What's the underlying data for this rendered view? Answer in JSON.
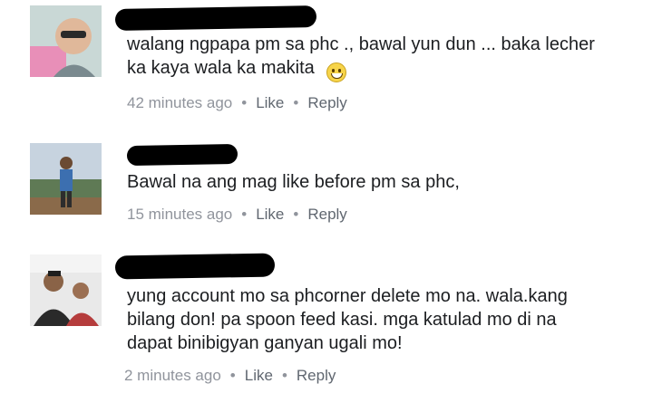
{
  "comments": [
    {
      "text": "walang ngpapa pm sa phc ., bawal yun dun ... baka lecher\nka kaya wala ka makita",
      "has_emoji": true,
      "time": "42 minutes ago",
      "like": "Like",
      "reply": "Reply"
    },
    {
      "text": "Bawal na ang mag like before pm sa phc,",
      "has_emoji": false,
      "time": "15 minutes ago",
      "like": "Like",
      "reply": "Reply"
    },
    {
      "text": "yung account mo sa phcorner delete mo na. wala.kang\nbilang don! pa spoon feed kasi. mga katulad mo di na\ndapat binibigyan ganyan ugali mo!",
      "has_emoji": false,
      "time": "2 minutes ago",
      "like": "Like",
      "reply": "Reply"
    }
  ],
  "separator": "•",
  "emoji_icon": "grinning-face-icon"
}
